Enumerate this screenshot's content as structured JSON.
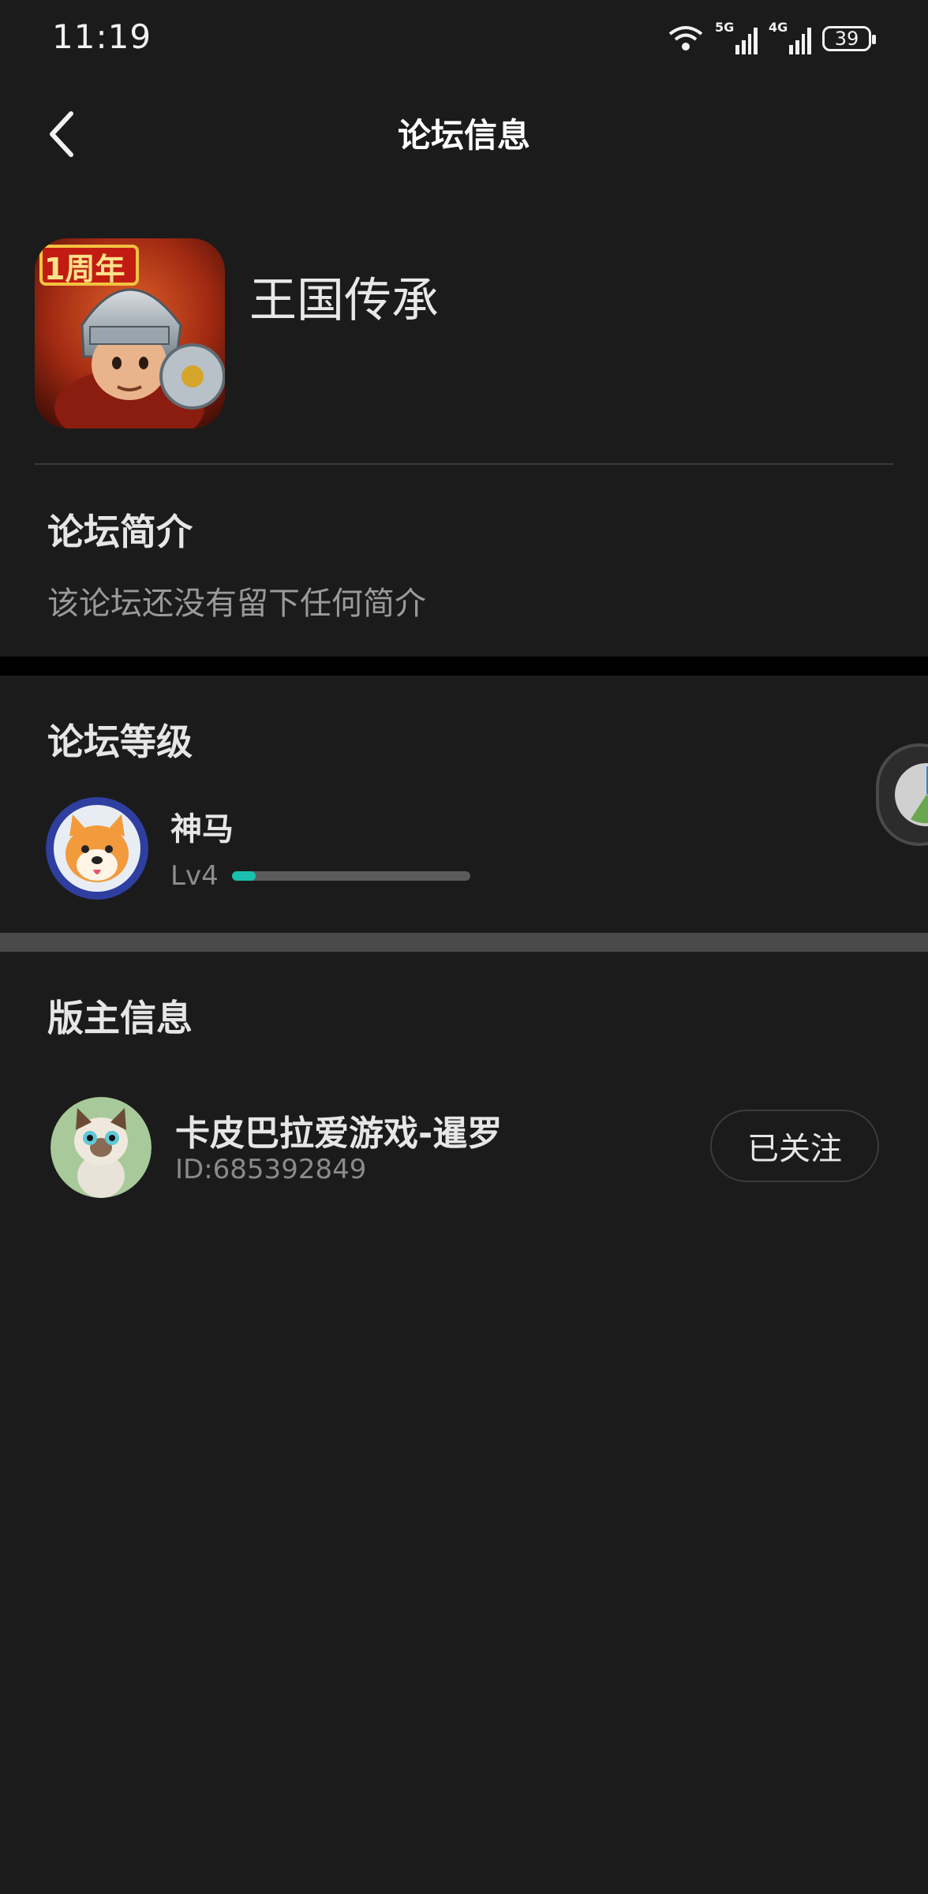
{
  "status_bar": {
    "time": "11:19",
    "net1": "5G",
    "net2": "4G",
    "battery": "39"
  },
  "header": {
    "title": "论坛信息"
  },
  "game": {
    "name": "王国传承",
    "icon_badge": "1周年"
  },
  "intro": {
    "title": "论坛简介",
    "text": "该论坛还没有留下任何简介"
  },
  "level": {
    "title": "论坛等级",
    "name": "神马",
    "label": "Lv4",
    "progress": 0.1,
    "progress_color": "#19c0b0"
  },
  "moderator": {
    "title": "版主信息",
    "name": "卡皮巴拉爱游戏-暹罗",
    "id": "ID:685392849",
    "follow_label": "已关注"
  }
}
